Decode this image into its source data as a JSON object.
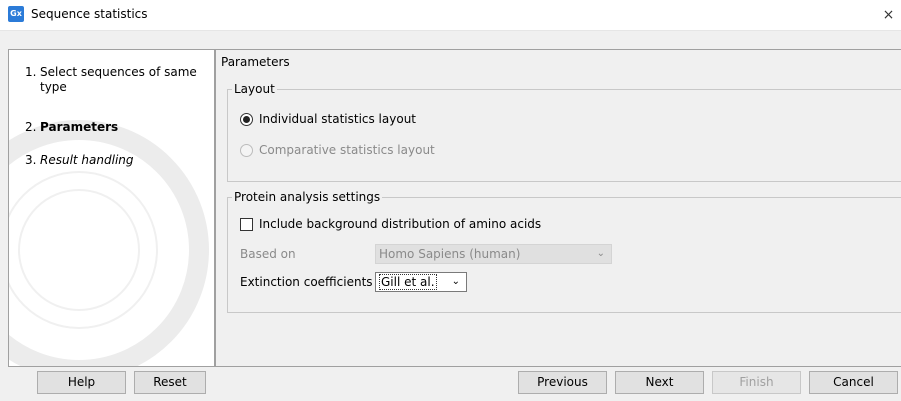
{
  "window": {
    "app_icon_text": "Gx",
    "title": "Sequence statistics",
    "close_glyph": "×"
  },
  "steps": [
    {
      "number": "1.",
      "label": "Select sequences of same type",
      "state": "normal"
    },
    {
      "number": "2.",
      "label": "Parameters",
      "state": "current"
    },
    {
      "number": "3.",
      "label": "Result handling",
      "state": "future"
    }
  ],
  "panel": {
    "title": "Parameters"
  },
  "layout_group": {
    "legend": "Layout",
    "options": [
      {
        "label": "Individual statistics layout",
        "selected": true,
        "enabled": true
      },
      {
        "label": "Comparative statistics layout",
        "selected": false,
        "enabled": false
      }
    ]
  },
  "protein_group": {
    "legend": "Protein analysis settings",
    "include_background": {
      "label": "Include background distribution of amino acids",
      "checked": false
    },
    "based_on": {
      "label": "Based on",
      "value": "Homo Sapiens (human)",
      "enabled": false
    },
    "extinction": {
      "label": "Extinction coefficients",
      "value": "Gill et al.",
      "enabled": true
    }
  },
  "buttons": {
    "help": "Help",
    "reset": "Reset",
    "previous": "Previous",
    "next": "Next",
    "finish": "Finish",
    "cancel": "Cancel"
  },
  "icons": {
    "close": "close-icon",
    "dropdown": "chevron-down-icon"
  },
  "colors": {
    "app_icon": "#2b7bd8",
    "window_bg": "#f0f0f0",
    "disabled_text": "#8a8a8a"
  }
}
